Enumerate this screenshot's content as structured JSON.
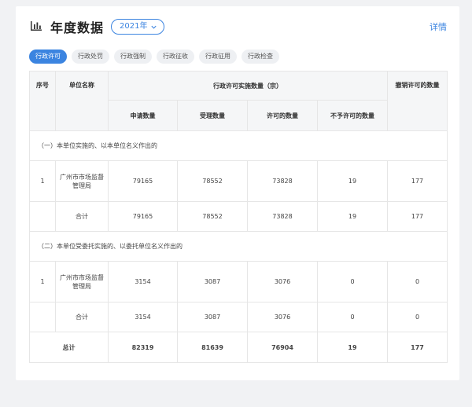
{
  "header": {
    "title": "年度数据",
    "year": "2021年",
    "detail_link": "详情"
  },
  "tabs": [
    {
      "label": "行政许可",
      "active": true
    },
    {
      "label": "行政处罚",
      "active": false
    },
    {
      "label": "行政强制",
      "active": false
    },
    {
      "label": "行政征收",
      "active": false
    },
    {
      "label": "行政征用",
      "active": false
    },
    {
      "label": "行政检查",
      "active": false
    }
  ],
  "table": {
    "col_index": "序号",
    "col_unit": "单位名称",
    "col_group": "行政许可实施数量（宗）",
    "col_revoked": "撤销许可的数量",
    "sub_cols": [
      "申请数量",
      "受理数量",
      "许可的数量",
      "不予许可的数量"
    ],
    "section1": "（一）本单位实施的、以本单位名义作出的",
    "section1_row": {
      "index": "1",
      "unit": "广州市市场监督管理局",
      "apply": "79165",
      "accept": "78552",
      "permit": "73828",
      "deny": "19",
      "revoke": "177"
    },
    "section1_sum": {
      "label": "合计",
      "apply": "79165",
      "accept": "78552",
      "permit": "73828",
      "deny": "19",
      "revoke": "177"
    },
    "section2": "（二）本单位受委托实施的、以委托单位名义作出的",
    "section2_row": {
      "index": "1",
      "unit": "广州市市场监督管理局",
      "apply": "3154",
      "accept": "3087",
      "permit": "3076",
      "deny": "0",
      "revoke": "0"
    },
    "section2_sum": {
      "label": "合计",
      "apply": "3154",
      "accept": "3087",
      "permit": "3076",
      "deny": "0",
      "revoke": "0"
    },
    "total": {
      "label": "总计",
      "apply": "82319",
      "accept": "81639",
      "permit": "76904",
      "deny": "19",
      "revoke": "177"
    }
  },
  "colors": {
    "accent": "#3b84e0",
    "header_bg": "#f5f6f7",
    "border": "#e6e6e6"
  }
}
